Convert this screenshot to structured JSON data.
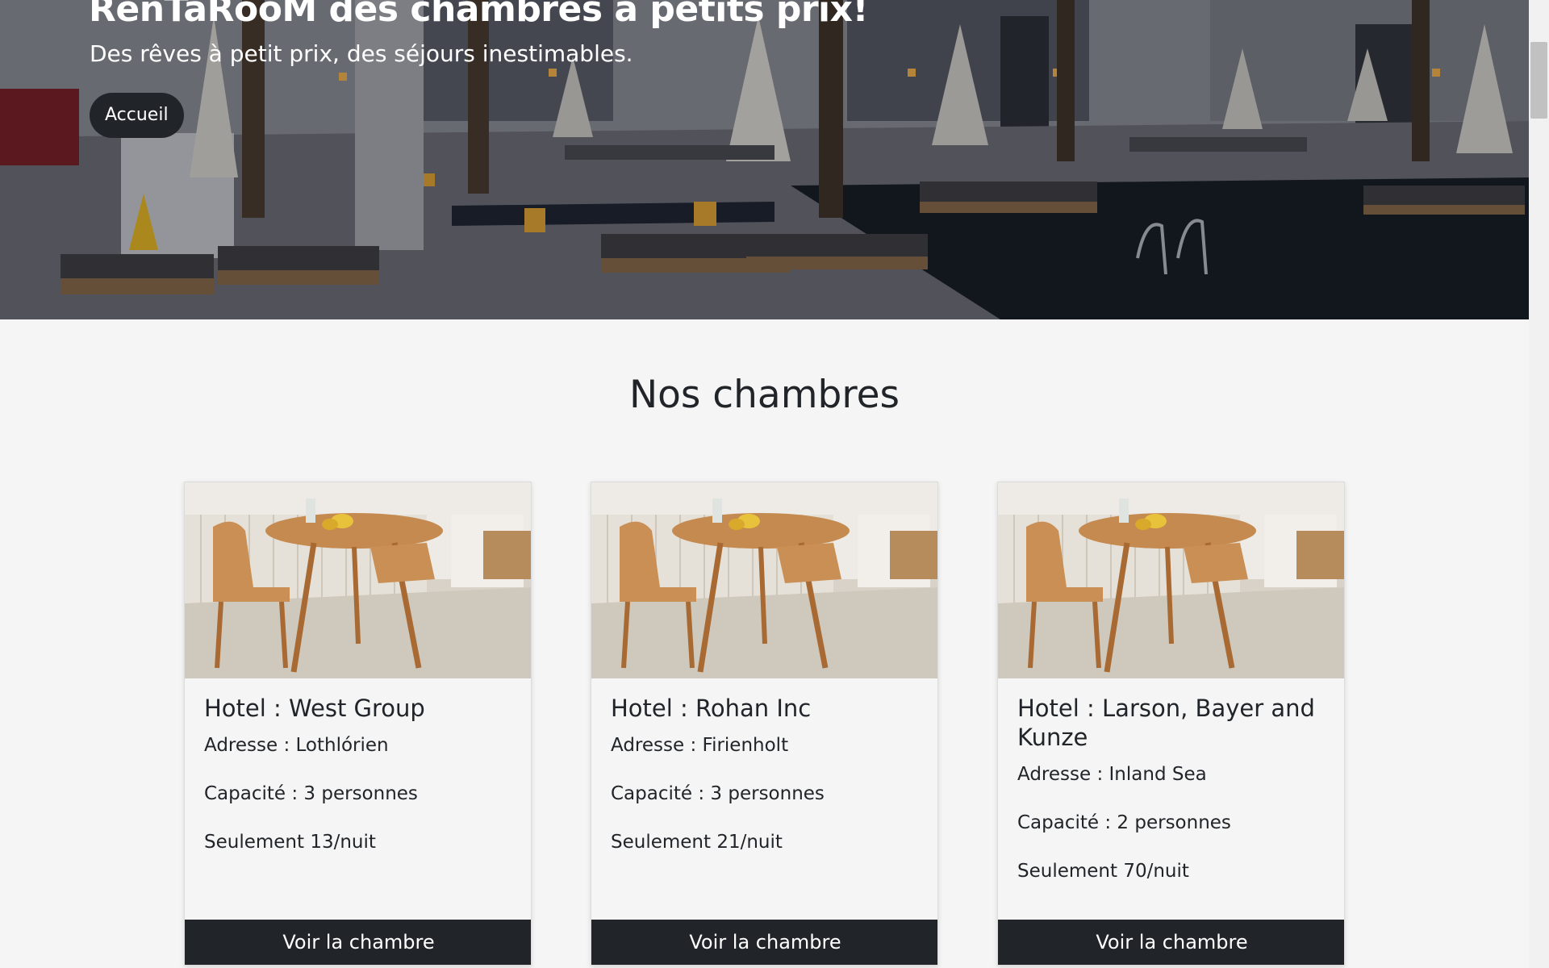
{
  "hero": {
    "title": "RenTaRooM des chambres à petits prix!",
    "subtitle": "Des rêves à petit prix, des séjours inestimables.",
    "home_button": "Accueil"
  },
  "section": {
    "title": "Nos chambres"
  },
  "cards": [
    {
      "hotel": "Hotel : West Group",
      "address": "Adresse : Lothlórien",
      "capacity": "Capacité : 3 personnes",
      "price": "Seulement 13/nuit",
      "button": "Voir la chambre"
    },
    {
      "hotel": "Hotel : Rohan Inc",
      "address": "Adresse : Firienholt",
      "capacity": "Capacité : 3 personnes",
      "price": "Seulement 21/nuit",
      "button": "Voir la chambre"
    },
    {
      "hotel": "Hotel : Larson, Bayer and Kunze",
      "address": "Adresse : Inland Sea",
      "capacity": "Capacité : 2 personnes",
      "price": "Seulement 70/nuit",
      "button": "Voir la chambre"
    }
  ],
  "colors": {
    "page_background": "#f5f5f5",
    "dark_button": "#212529",
    "text": "#212529"
  }
}
